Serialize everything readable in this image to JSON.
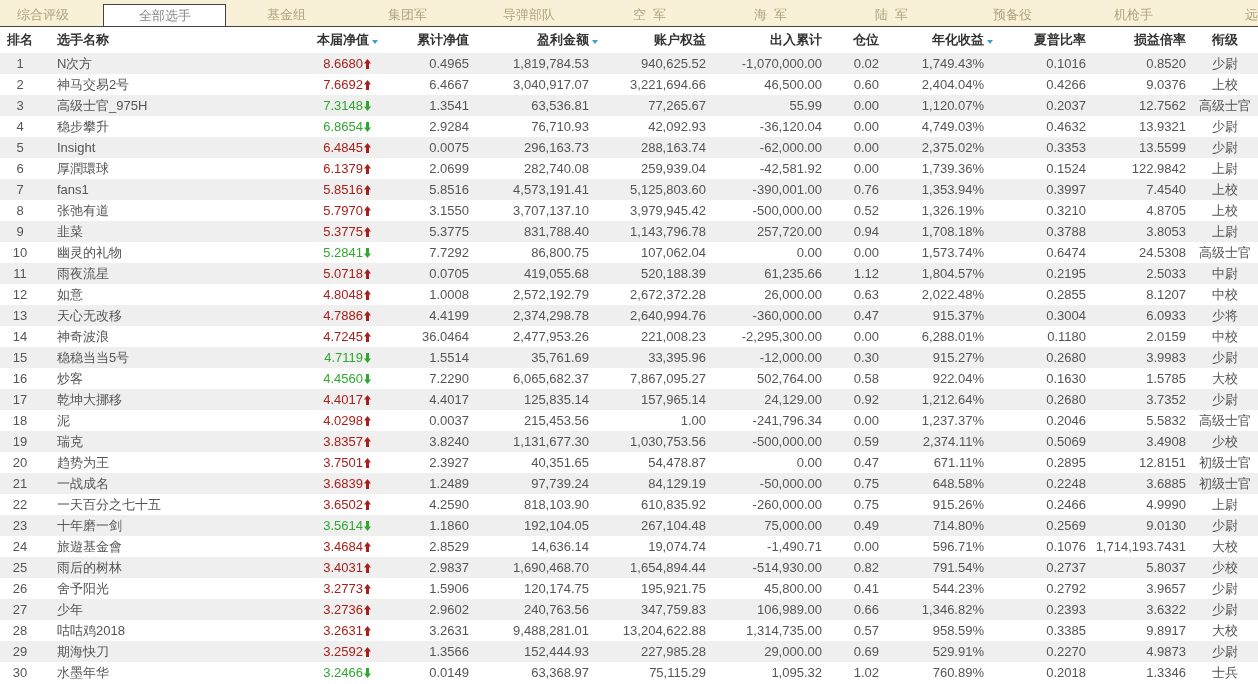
{
  "tabs": [
    {
      "label": "综合评级",
      "selected": false
    },
    {
      "label": "全部选手",
      "selected": true
    },
    {
      "label": "基金组",
      "selected": false
    },
    {
      "label": "集团军",
      "selected": false
    },
    {
      "label": "导弹部队",
      "selected": false
    },
    {
      "label": "空  军",
      "selected": false
    },
    {
      "label": "海  军",
      "selected": false
    },
    {
      "label": "陆  军",
      "selected": false
    },
    {
      "label": "预备役",
      "selected": false
    },
    {
      "label": "机枪手",
      "selected": false
    },
    {
      "label": "远",
      "selected": false,
      "kind": "edge"
    }
  ],
  "table": {
    "columns": [
      {
        "label": "排名",
        "sort_indicator": false
      },
      {
        "label": "选手名称",
        "sort_indicator": false
      },
      {
        "label": "本届净值",
        "sort_indicator": true
      },
      {
        "label": "累计净值",
        "sort_indicator": false
      },
      {
        "label": "盈利金额",
        "sort_indicator": true
      },
      {
        "label": "账户权益",
        "sort_indicator": false
      },
      {
        "label": "出入累计",
        "sort_indicator": false
      },
      {
        "label": "仓位",
        "sort_indicator": false
      },
      {
        "label": "年化收益",
        "sort_indicator": true
      },
      {
        "label": "夏普比率",
        "sort_indicator": false
      },
      {
        "label": "损益倍率",
        "sort_indicator": false
      },
      {
        "label": "衔级",
        "sort_indicator": false
      }
    ],
    "rows": [
      {
        "rising": true,
        "cells": [
          "1",
          "N次方",
          "8.6680",
          "0.4965",
          "1,819,784.53",
          "940,625.52",
          "-1,070,000.00",
          "0.02",
          "1,749.43%",
          "0.1016",
          "0.8520",
          "少尉"
        ]
      },
      {
        "rising": true,
        "cells": [
          "2",
          "神马交易2号",
          "7.6692",
          "6.4667",
          "3,040,917.07",
          "3,221,694.66",
          "46,500.00",
          "0.60",
          "2,404.04%",
          "0.4266",
          "9.0376",
          "上校"
        ]
      },
      {
        "rising": false,
        "cells": [
          "3",
          "高级士官_975H",
          "7.3148",
          "1.3541",
          "63,536.81",
          "77,265.67",
          "55.99",
          "0.00",
          "1,120.07%",
          "0.2037",
          "12.7562",
          "高级士官"
        ]
      },
      {
        "rising": false,
        "cells": [
          "4",
          "稳步攀升",
          "6.8654",
          "2.9284",
          "76,710.93",
          "42,092.93",
          "-36,120.04",
          "0.00",
          "4,749.03%",
          "0.4632",
          "13.9321",
          "少尉"
        ]
      },
      {
        "rising": true,
        "cells": [
          "5",
          "Insight",
          "6.4845",
          "0.0075",
          "296,163.73",
          "288,163.74",
          "-62,000.00",
          "0.00",
          "2,375.02%",
          "0.3353",
          "13.5599",
          "少尉"
        ]
      },
      {
        "rising": true,
        "cells": [
          "6",
          "厚潤環球",
          "6.1379",
          "2.0699",
          "282,740.08",
          "259,939.04",
          "-42,581.92",
          "0.00",
          "1,739.36%",
          "0.1524",
          "122.9842",
          "上尉"
        ]
      },
      {
        "rising": true,
        "cells": [
          "7",
          "fans1",
          "5.8516",
          "5.8516",
          "4,573,191.41",
          "5,125,803.60",
          "-390,001.00",
          "0.76",
          "1,353.94%",
          "0.3997",
          "7.4540",
          "上校"
        ]
      },
      {
        "rising": true,
        "cells": [
          "8",
          "张弛有道",
          "5.7970",
          "3.1550",
          "3,707,137.10",
          "3,979,945.42",
          "-500,000.00",
          "0.52",
          "1,326.19%",
          "0.3210",
          "4.8705",
          "上校"
        ]
      },
      {
        "rising": true,
        "cells": [
          "9",
          "韭菜",
          "5.3775",
          "5.3775",
          "831,788.40",
          "1,143,796.78",
          "257,720.00",
          "0.94",
          "1,708.18%",
          "0.3788",
          "3.8053",
          "上尉"
        ]
      },
      {
        "rising": false,
        "cells": [
          "10",
          "幽灵的礼物",
          "5.2841",
          "7.7292",
          "86,800.75",
          "107,062.04",
          "0.00",
          "0.00",
          "1,573.74%",
          "0.6474",
          "24.5308",
          "高级士官"
        ]
      },
      {
        "rising": true,
        "cells": [
          "11",
          "雨夜流星",
          "5.0718",
          "0.0705",
          "419,055.68",
          "520,188.39",
          "61,235.66",
          "1.12",
          "1,804.57%",
          "0.2195",
          "2.5033",
          "中尉"
        ]
      },
      {
        "rising": true,
        "cells": [
          "12",
          "如意",
          "4.8048",
          "1.0008",
          "2,572,192.79",
          "2,672,372.28",
          "26,000.00",
          "0.63",
          "2,022.48%",
          "0.2855",
          "8.1207",
          "中校"
        ]
      },
      {
        "rising": true,
        "cells": [
          "13",
          "天心无改移",
          "4.7886",
          "4.4199",
          "2,374,298.78",
          "2,640,994.76",
          "-360,000.00",
          "0.47",
          "915.37%",
          "0.3004",
          "6.0933",
          "少将"
        ]
      },
      {
        "rising": true,
        "cells": [
          "14",
          "神奇波浪",
          "4.7245",
          "36.0464",
          "2,477,953.26",
          "221,008.23",
          "-2,295,300.00",
          "0.00",
          "6,288.01%",
          "0.1180",
          "2.0159",
          "中校"
        ]
      },
      {
        "rising": false,
        "cells": [
          "15",
          "稳稳当当5号",
          "4.7119",
          "1.5514",
          "35,761.69",
          "33,395.96",
          "-12,000.00",
          "0.30",
          "915.27%",
          "0.2680",
          "3.9983",
          "少尉"
        ]
      },
      {
        "rising": false,
        "cells": [
          "16",
          "炒客",
          "4.4560",
          "7.2290",
          "6,065,682.37",
          "7,867,095.27",
          "502,764.00",
          "0.58",
          "922.04%",
          "0.1630",
          "1.5785",
          "大校"
        ]
      },
      {
        "rising": true,
        "cells": [
          "17",
          "乾坤大挪移",
          "4.4017",
          "4.4017",
          "125,835.14",
          "157,965.14",
          "24,129.00",
          "0.92",
          "1,212.64%",
          "0.2680",
          "3.7352",
          "少尉"
        ]
      },
      {
        "rising": true,
        "cells": [
          "18",
          "泥",
          "4.0298",
          "0.0037",
          "215,453.56",
          "1.00",
          "-241,796.34",
          "0.00",
          "1,237.37%",
          "0.2046",
          "5.5832",
          "高级士官"
        ]
      },
      {
        "rising": true,
        "cells": [
          "19",
          "瑞克",
          "3.8357",
          "3.8240",
          "1,131,677.30",
          "1,030,753.56",
          "-500,000.00",
          "0.59",
          "2,374.11%",
          "0.5069",
          "3.4908",
          "少校"
        ]
      },
      {
        "rising": true,
        "cells": [
          "20",
          "趋势为王",
          "3.7501",
          "2.3927",
          "40,351.65",
          "54,478.87",
          "0.00",
          "0.47",
          "671.11%",
          "0.2895",
          "12.8151",
          "初级士官"
        ]
      },
      {
        "rising": true,
        "cells": [
          "21",
          "一战成名",
          "3.6839",
          "1.2489",
          "97,739.24",
          "84,129.19",
          "-50,000.00",
          "0.75",
          "648.58%",
          "0.2248",
          "3.6885",
          "初级士官"
        ]
      },
      {
        "rising": true,
        "cells": [
          "22",
          "一天百分之七十五",
          "3.6502",
          "4.2590",
          "818,103.90",
          "610,835.92",
          "-260,000.00",
          "0.75",
          "915.26%",
          "0.2466",
          "4.9990",
          "上尉"
        ]
      },
      {
        "rising": false,
        "cells": [
          "23",
          "十年磨一剑",
          "3.5614",
          "1.1860",
          "192,104.05",
          "267,104.48",
          "75,000.00",
          "0.49",
          "714.80%",
          "0.2569",
          "9.0130",
          "少尉"
        ]
      },
      {
        "rising": true,
        "cells": [
          "24",
          "旅遊基金會",
          "3.4684",
          "2.8529",
          "14,636.14",
          "19,074.74",
          "-1,490.71",
          "0.00",
          "596.71%",
          "0.1076",
          "1,714,193.7431",
          "大校"
        ]
      },
      {
        "rising": true,
        "cells": [
          "25",
          "雨后的树林",
          "3.4031",
          "2.9837",
          "1,690,468.70",
          "1,654,894.44",
          "-514,930.00",
          "0.82",
          "791.54%",
          "0.2737",
          "5.8037",
          "少校"
        ]
      },
      {
        "rising": true,
        "cells": [
          "26",
          "舍予阳光",
          "3.2773",
          "1.5906",
          "120,174.75",
          "195,921.75",
          "45,800.00",
          "0.41",
          "544.23%",
          "0.2792",
          "3.9657",
          "少尉"
        ]
      },
      {
        "rising": true,
        "cells": [
          "27",
          "少年",
          "3.2736",
          "2.9602",
          "240,763.56",
          "347,759.83",
          "106,989.00",
          "0.66",
          "1,346.82%",
          "0.2393",
          "3.6322",
          "少尉"
        ]
      },
      {
        "rising": true,
        "cells": [
          "28",
          "咕咕鸡2018",
          "3.2631",
          "3.2631",
          "9,488,281.01",
          "13,204,622.88",
          "1,314,735.00",
          "0.57",
          "958.59%",
          "0.3385",
          "9.8917",
          "大校"
        ]
      },
      {
        "rising": true,
        "cells": [
          "29",
          "期海快刀",
          "3.2592",
          "1.3566",
          "152,444.93",
          "227,985.28",
          "29,000.00",
          "0.69",
          "529.91%",
          "0.2270",
          "4.9873",
          "少尉"
        ]
      },
      {
        "rising": false,
        "cells": [
          "30",
          "水墨年华",
          "3.2466",
          "0.0149",
          "63,368.97",
          "75,115.29",
          "1,095.32",
          "1.02",
          "760.89%",
          "0.2018",
          "1.3346",
          "士兵"
        ]
      }
    ]
  }
}
